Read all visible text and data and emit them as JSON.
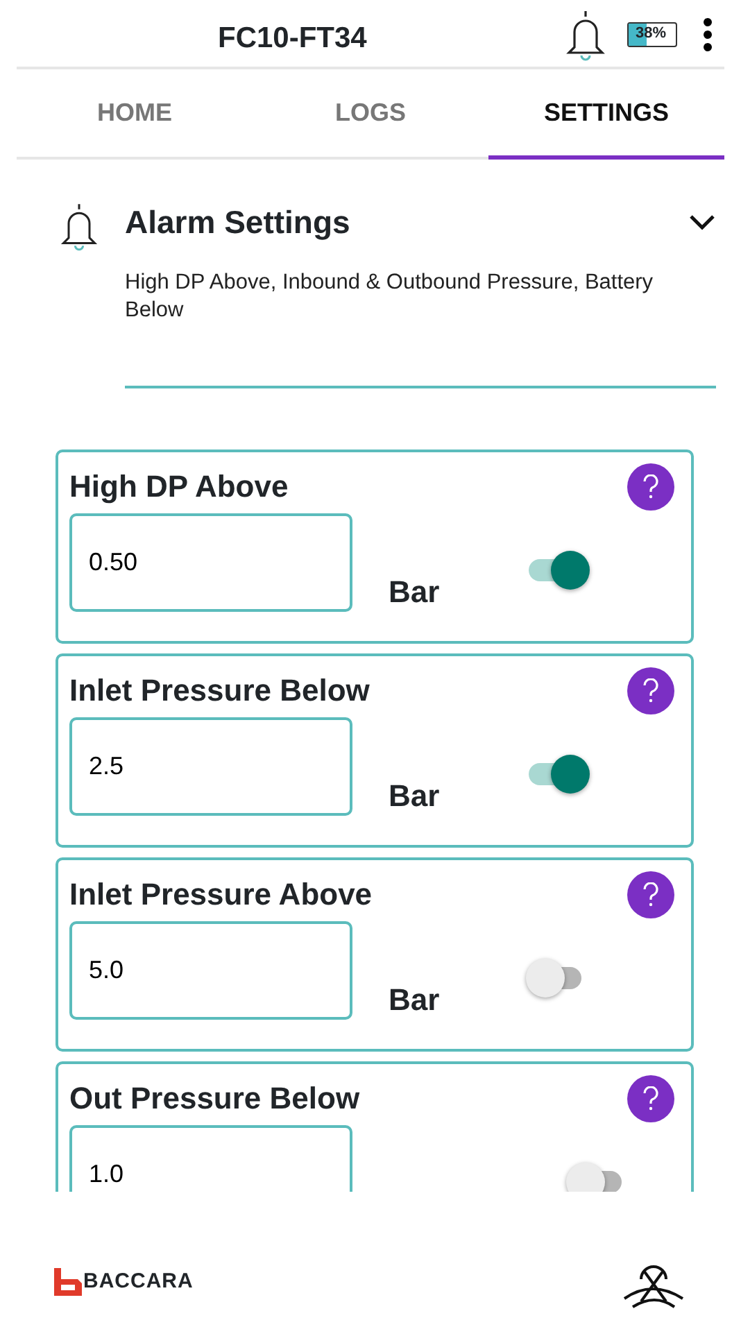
{
  "header": {
    "title": "FC10-FT34",
    "battery": "38%"
  },
  "tabs": [
    {
      "label": "HOME",
      "selected": false
    },
    {
      "label": "LOGS",
      "selected": false
    },
    {
      "label": "SETTINGS",
      "selected": true
    }
  ],
  "section": {
    "title": "Alarm Settings",
    "subtitle": "High DP Above, Inbound & Outbound Pressure, Battery Below",
    "expanded": true
  },
  "alarms": [
    {
      "name": "High DP Above",
      "value": "0.50",
      "unit": "Bar",
      "on": true
    },
    {
      "name": "Inlet Pressure Below",
      "value": "2.5",
      "unit": "Bar",
      "on": true
    },
    {
      "name": "Inlet Pressure Above",
      "value": "5.0",
      "unit": "Bar",
      "on": false
    },
    {
      "name": "Out Pressure Below",
      "value": "1.0",
      "on": false
    }
  ],
  "footer": {
    "logo": "BACCARA"
  }
}
